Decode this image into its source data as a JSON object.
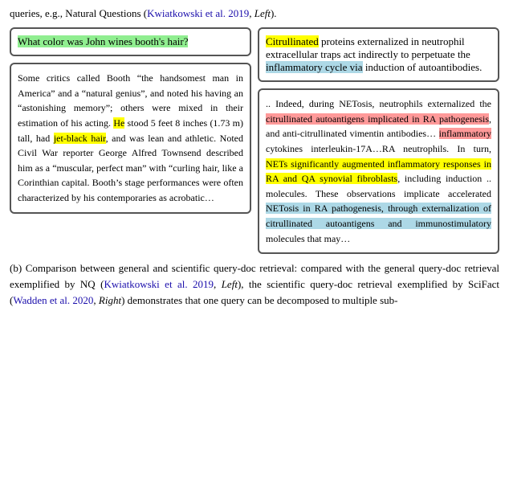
{
  "header": {
    "text": "queries, e.g., Natural Questions (",
    "link1": "Kwiatkowski et al. 2019",
    "comma": ", ",
    "italic1": "Left",
    "close1": ")."
  },
  "left_query": "What color was John wines booth's hair?",
  "left_doc": {
    "parts": [
      {
        "text": "Some critics called Booth “the handsomest man in America” and a “natural genius”, and noted his having an “astonishing memory”; others were mixed in their estimation of his acting. "
      },
      {
        "text": "He stood 5 feet 8 inches (1.73 m) tall, had ",
        "hl": "none"
      },
      {
        "text": "jet-black hair",
        "hl": "green"
      },
      {
        "text": ", and was lean and athletic. Noted Civil War reporter George Alfred Townsend described him as a “muscular, perfect man” with “curling hair, like a Corinthian capital. Booth’s stage performances were often characterized by his contemporaries as acrobatic…"
      }
    ],
    "he_had": "He stood 5 feet 8 inches (1.73 m) tall, had "
  },
  "right_query": {
    "parts": [
      {
        "text": "Citrullinated",
        "hl": "yellow"
      },
      {
        "text": " proteins externalized in neutrophil extracellular traps act indirectly to perpetuate the ",
        "hl": "none"
      },
      {
        "text": "inflammatory cycle via",
        "hl": "blue"
      },
      {
        "text": " induction of autoantibodies.",
        "hl": "none"
      }
    ]
  },
  "right_doc": {
    "parts": [
      {
        "text": ".. Indeed, during NETosis, neutrophils externalized the "
      },
      {
        "text": "citrullinated autoantigens implicated in RA pathogenesis",
        "hl": "red"
      },
      {
        "text": ", and anti-citrullinated vimentin antibodies… "
      },
      {
        "text": "inflammatory",
        "hl": "none"
      },
      {
        "text": " cytokines interleukin-17A…RA neutrophils. In turn, "
      },
      {
        "text": "NETs significantly augmented inflammatory responses in RA and QA synovial fibroblasts",
        "hl": "yellow"
      },
      {
        "text": ", including induction .. molecules. These observations implicate accelerated "
      },
      {
        "text": "NETosis in RA pathogenesis, through externalization of citrullinated autoantigens and immunostimulatory",
        "hl": "blue"
      },
      {
        "text": " molecules that may…"
      }
    ]
  },
  "bottom_text": "(b) Comparison between general and scientific query-doc retrieval: compared with the general query-doc retrieval exemplified by NQ (",
  "bottom_link1": "Kwiatkowski et al. 2019",
  "bottom_mid1": ", ",
  "bottom_italic1": "Left",
  "bottom_mid2": "), the scientific query-doc retrieval exemplified by SciFact (",
  "bottom_link2": "Wadden et al. 2020",
  "bottom_mid3": ", ",
  "bottom_italic2": "Right",
  "bottom_end": ") demonstrates that one query can be decomposed to multiple sub-"
}
